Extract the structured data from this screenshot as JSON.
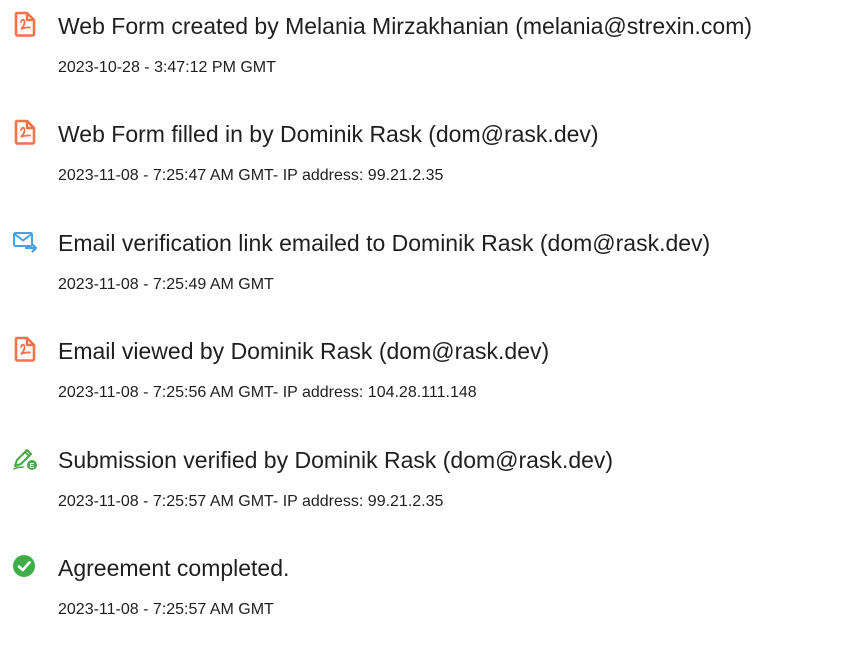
{
  "events": [
    {
      "icon": "document-icon",
      "title": "Web Form created by Melania Mirzakhanian (melania@strexin.com)",
      "meta": "2023-10-28 - 3:47:12 PM GMT"
    },
    {
      "icon": "document-icon",
      "title": "Web Form filled in by Dominik Rask (dom@rask.dev)",
      "meta": "2023-11-08 - 7:25:47 AM GMT- IP address: 99.21.2.35"
    },
    {
      "icon": "email-forward-icon",
      "title": "Email verification link emailed to Dominik Rask (dom@rask.dev)",
      "meta": "2023-11-08 - 7:25:49 AM GMT"
    },
    {
      "icon": "document-icon",
      "title": "Email viewed by Dominik Rask (dom@rask.dev)",
      "meta": "2023-11-08 - 7:25:56 AM GMT- IP address: 104.28.111.148"
    },
    {
      "icon": "signature-pen-icon",
      "title": "Submission verified by Dominik Rask (dom@rask.dev)",
      "meta": "2023-11-08 - 7:25:57 AM GMT- IP address: 99.21.2.35"
    },
    {
      "icon": "check-circle-icon",
      "title": "Agreement completed.",
      "meta": "2023-11-08 - 7:25:57 AM GMT"
    }
  ],
  "colors": {
    "document_icon": "#f2724a",
    "email_icon": "#4a9fe0",
    "signature_icon": "#4aa84a",
    "check_icon": "#3fae49",
    "text": "#1f1f1f"
  }
}
